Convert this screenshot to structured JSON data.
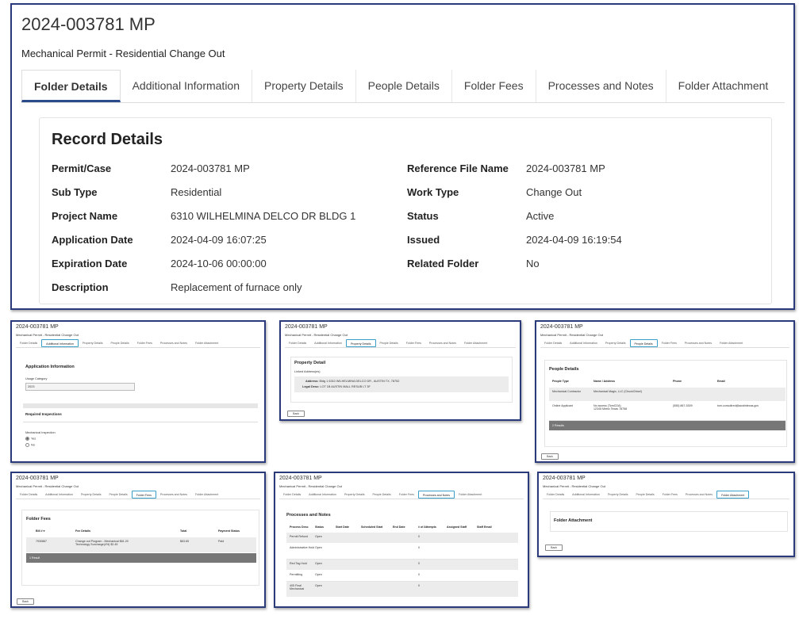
{
  "main": {
    "folder_number": "2024-003781 MP",
    "folder_type": "Mechanical Permit - Residential Change Out",
    "tabs": [
      "Folder Details",
      "Additional Information",
      "Property Details",
      "People Details",
      "Folder Fees",
      "Processes and Notes",
      "Folder Attachment"
    ],
    "active_tab": "Folder Details",
    "record": {
      "heading": "Record Details",
      "rows": [
        {
          "l1": "Permit/Case",
          "v1": "2024-003781 MP",
          "l2": "Reference File Name",
          "v2": "2024-003781 MP"
        },
        {
          "l1": "Sub Type",
          "v1": "Residential",
          "l2": "Work Type",
          "v2": "Change Out"
        },
        {
          "l1": "Project Name",
          "v1": "6310 WILHELMINA DELCO DR BLDG 1",
          "l2": "Status",
          "v2": "Active"
        },
        {
          "l1": "Application Date",
          "v1": "2024-04-09 16:07:25",
          "l2": "Issued",
          "v2": "2024-04-09 16:19:54"
        },
        {
          "l1": "Expiration Date",
          "v1": "2024-10-06 00:00:00",
          "l2": "Related Folder",
          "v2": "No"
        },
        {
          "l1": "Description",
          "v1": "Replacement of furnace only",
          "l2": "",
          "v2": ""
        }
      ]
    }
  },
  "mini": {
    "folder_number": "2024-003781 MP",
    "folder_type": "Mechanical Permit - Residential Change Out",
    "tabs": [
      "Folder Details",
      "Additional Information",
      "Property Details",
      "People Details",
      "Folder Fees",
      "Processes and Notes",
      "Folder Attachment"
    ],
    "back_label": "Back"
  },
  "additional": {
    "heading": "Application Information",
    "usage_label": "Usage Category",
    "usage_value": "2023",
    "inspections_heading": "Required Inspections",
    "mech_label": "Mechanical Inspection",
    "yes": "Yes",
    "no": "No"
  },
  "property": {
    "heading": "Property Detail",
    "linked": "Linked Address(es)",
    "address_label": "Address:",
    "address_value": "Bldg 1 6310 WILHELMINA DELCO DR , AUSTIN TX, 78752",
    "legal_label": "Legal Desc:",
    "legal_value": "LOT 1B AUSTIN MALL RESUB LT 3F"
  },
  "people": {
    "heading": "People Details",
    "columns": [
      "People Type",
      "Name / Address",
      "Phone",
      "Email"
    ],
    "rows": [
      {
        "type": "Mechanical Contractor",
        "name": "Mechanical Magic, LLC (ChuckChisel)",
        "name2": "",
        "phone": "",
        "email": ""
      },
      {
        "type": "Online Applicant",
        "name": "No access (TomCDA)",
        "name2": "12345 Metric Texas 78758",
        "phone": "(555) 867-5309",
        "email": "tom.consoltred@austintexas.gov"
      }
    ],
    "results": "2 Results"
  },
  "fees": {
    "heading": "Folder Fees",
    "columns": [
      "Bill # ▾",
      "Fee Details",
      "Total",
      "Payment Status"
    ],
    "rows": [
      {
        "bill": "7930867",
        "d1": "Change out Program - Mechanical $61.20",
        "d2": "Technology Surcharge(4%) $2.45",
        "total": "$63.65",
        "status": "Paid"
      }
    ],
    "results": "1 Result"
  },
  "processes": {
    "heading": "Processes and Notes",
    "columns": [
      "Process Desc",
      "Status",
      "Start Date",
      "Scheduled Start",
      "End Date",
      "# of Attempts",
      "Assigned Staff",
      "Staff Email"
    ],
    "rows": [
      {
        "desc": "Permit Refund",
        "status": "Open",
        "attempts": "0"
      },
      {
        "desc": "Administrative Hold",
        "status": "Open",
        "attempts": "0"
      },
      {
        "desc": "Red Tag Hold",
        "status": "Open",
        "attempts": "0"
      },
      {
        "desc": "Permitting",
        "status": "Open",
        "attempts": "0"
      },
      {
        "desc": "405 Final Mechanical",
        "status": "Open",
        "attempts": "0"
      }
    ]
  },
  "attachment": {
    "heading": "Folder Attachment"
  },
  "colors": {
    "panel_border": "#2b3a7a",
    "active_tab_underline": "#2b4a8a",
    "mini_active_tab": "#3aa0c8"
  }
}
